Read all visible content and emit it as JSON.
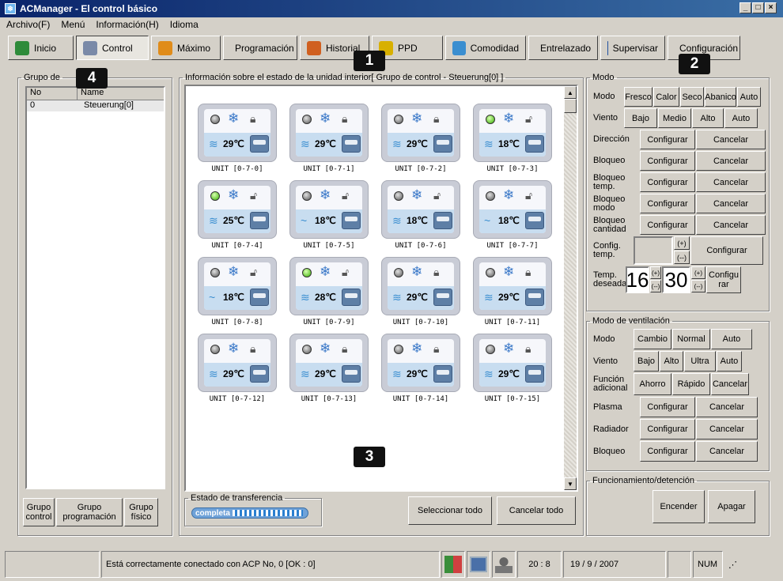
{
  "window": {
    "title": "ACManager - El control básico",
    "app_icon": "snowflake-app-icon"
  },
  "menu": [
    "Archivo(F)",
    "Menú",
    "Información(H)",
    "Idioma"
  ],
  "toolbar": [
    {
      "label": "Inicio",
      "icon": "house-icon",
      "color": "#2e8b3a"
    },
    {
      "label": "Control",
      "icon": "remote-icon",
      "color": "#7a8aa8",
      "active": true
    },
    {
      "label": "Máximo",
      "icon": "bar-chart-icon",
      "color": "#e08c1a"
    },
    {
      "label": "Programación",
      "icon": "clock-icon",
      "color": "#b0b0b0"
    },
    {
      "label": "Historial",
      "icon": "pencil-icon",
      "color": "#d06020"
    },
    {
      "label": "PPD",
      "icon": "ppd-icon",
      "color": "#d8b000"
    },
    {
      "label": "Comodidad",
      "icon": "comfort-icon",
      "color": "#3a8ed0"
    },
    {
      "label": "Entrelazado",
      "icon": "interlock-icon",
      "color": "#9a7ab0"
    },
    {
      "label": "Supervisar",
      "icon": "monitor-icon",
      "color": "#2050a0"
    },
    {
      "label": "Configuración",
      "icon": "tools-icon",
      "color": "#a05020"
    }
  ],
  "badges": [
    "1",
    "2",
    "3",
    "4"
  ],
  "group_panel": {
    "legend": "Grupo de",
    "columns": [
      "No",
      "Name"
    ],
    "rows": [
      {
        "no": "0",
        "name": "Steuerung[0]"
      }
    ],
    "buttons": [
      [
        "Grupo",
        "control"
      ],
      [
        "Grupo",
        "programación"
      ],
      [
        "Grupo",
        "físico"
      ]
    ]
  },
  "units_panel": {
    "legend": "Información sobre el estado de la unidad interior[ Grupo de control - Steuerung[0] ]",
    "units": [
      {
        "name": "UNIT [0-7-0]",
        "on": false,
        "locked": true,
        "wind": "≋",
        "temp": "29℃"
      },
      {
        "name": "UNIT [0-7-1]",
        "on": false,
        "locked": true,
        "wind": "≋",
        "temp": "29℃"
      },
      {
        "name": "UNIT [0-7-2]",
        "on": false,
        "locked": true,
        "wind": "≋",
        "temp": "29℃"
      },
      {
        "name": "UNIT [0-7-3]",
        "on": true,
        "locked": false,
        "wind": "≋",
        "temp": "18℃"
      },
      {
        "name": "UNIT [0-7-4]",
        "on": true,
        "locked": false,
        "wind": "≋",
        "temp": "25℃"
      },
      {
        "name": "UNIT [0-7-5]",
        "on": false,
        "locked": false,
        "wind": "~",
        "temp": "18℃"
      },
      {
        "name": "UNIT [0-7-6]",
        "on": false,
        "locked": false,
        "wind": "≋",
        "temp": "18℃"
      },
      {
        "name": "UNIT [0-7-7]",
        "on": false,
        "locked": false,
        "wind": "~",
        "temp": "18℃"
      },
      {
        "name": "UNIT [0-7-8]",
        "on": false,
        "locked": false,
        "wind": "~",
        "temp": "18℃"
      },
      {
        "name": "UNIT [0-7-9]",
        "on": true,
        "locked": false,
        "wind": "≋",
        "temp": "28℃"
      },
      {
        "name": "UNIT [0-7-10]",
        "on": false,
        "locked": true,
        "wind": "≋",
        "temp": "29℃"
      },
      {
        "name": "UNIT [0-7-11]",
        "on": false,
        "locked": true,
        "wind": "≋",
        "temp": "29℃"
      },
      {
        "name": "UNIT [0-7-12]",
        "on": false,
        "locked": true,
        "wind": "≋",
        "temp": "29℃"
      },
      {
        "name": "UNIT [0-7-13]",
        "on": false,
        "locked": true,
        "wind": "≋",
        "temp": "29℃"
      },
      {
        "name": "UNIT [0-7-14]",
        "on": false,
        "locked": true,
        "wind": "≋",
        "temp": "29℃"
      },
      {
        "name": "UNIT [0-7-15]",
        "on": false,
        "locked": true,
        "wind": "≋",
        "temp": "29℃"
      }
    ]
  },
  "transfer": {
    "legend": "Estado de transferencia",
    "status": "completa",
    "progress": 1.0
  },
  "select_all": "Seleccionar todo",
  "cancel_all": "Cancelar todo",
  "modo_panel": {
    "legend": "Modo",
    "modo_label": "Modo",
    "modos": [
      "Fresco",
      "Calor",
      "Seco",
      "Abanico",
      "Auto"
    ],
    "viento_label": "Viento",
    "vientos": [
      "Bajo",
      "Medio",
      "Alto",
      "Auto"
    ],
    "rows": [
      {
        "label": "Dirección",
        "a": "Configurar",
        "b": "Cancelar"
      },
      {
        "label": "Bloqueo",
        "a": "Configurar",
        "b": "Cancelar"
      },
      {
        "label": "Bloqueo temp.",
        "a": "Configurar",
        "b": "Cancelar"
      },
      {
        "label": "Bloqueo modo",
        "a": "Configurar",
        "b": "Cancelar"
      },
      {
        "label": "Bloqueo cantidad",
        "a": "Configurar",
        "b": "Cancelar"
      }
    ],
    "config_temp_label": "Config. temp.",
    "plus": "(+)",
    "minus": "(--)",
    "configurar": "Configurar",
    "temp_deseada_label": "Temp. deseada",
    "temp_min": "16",
    "temp_max": "30",
    "configurar2": "Configu rar"
  },
  "vent_panel": {
    "legend": "Modo de ventilación",
    "modo_label": "Modo",
    "modos": [
      "Cambio",
      "Normal",
      "Auto"
    ],
    "viento_label": "Viento",
    "vientos": [
      "Bajo",
      "Alto",
      "Ultra",
      "Auto"
    ],
    "funcion_label": "Función adicional",
    "funciones": [
      "Ahorro",
      "Rápido",
      "Cancelar"
    ],
    "rows": [
      {
        "label": "Plasma",
        "a": "Configurar",
        "b": "Cancelar"
      },
      {
        "label": "Radiador",
        "a": "Configurar",
        "b": "Cancelar"
      },
      {
        "label": "Bloqueo",
        "a": "Configurar",
        "b": "Cancelar"
      }
    ]
  },
  "power_panel": {
    "legend": "Funcionamiento/detención",
    "on": "Encender",
    "off": "Apagar"
  },
  "status": {
    "message": "Está correctamente conectado con ACP No, 0 [OK : 0]",
    "time": "20 : 8",
    "date": "19 / 9 / 2007",
    "num": "NUM"
  }
}
